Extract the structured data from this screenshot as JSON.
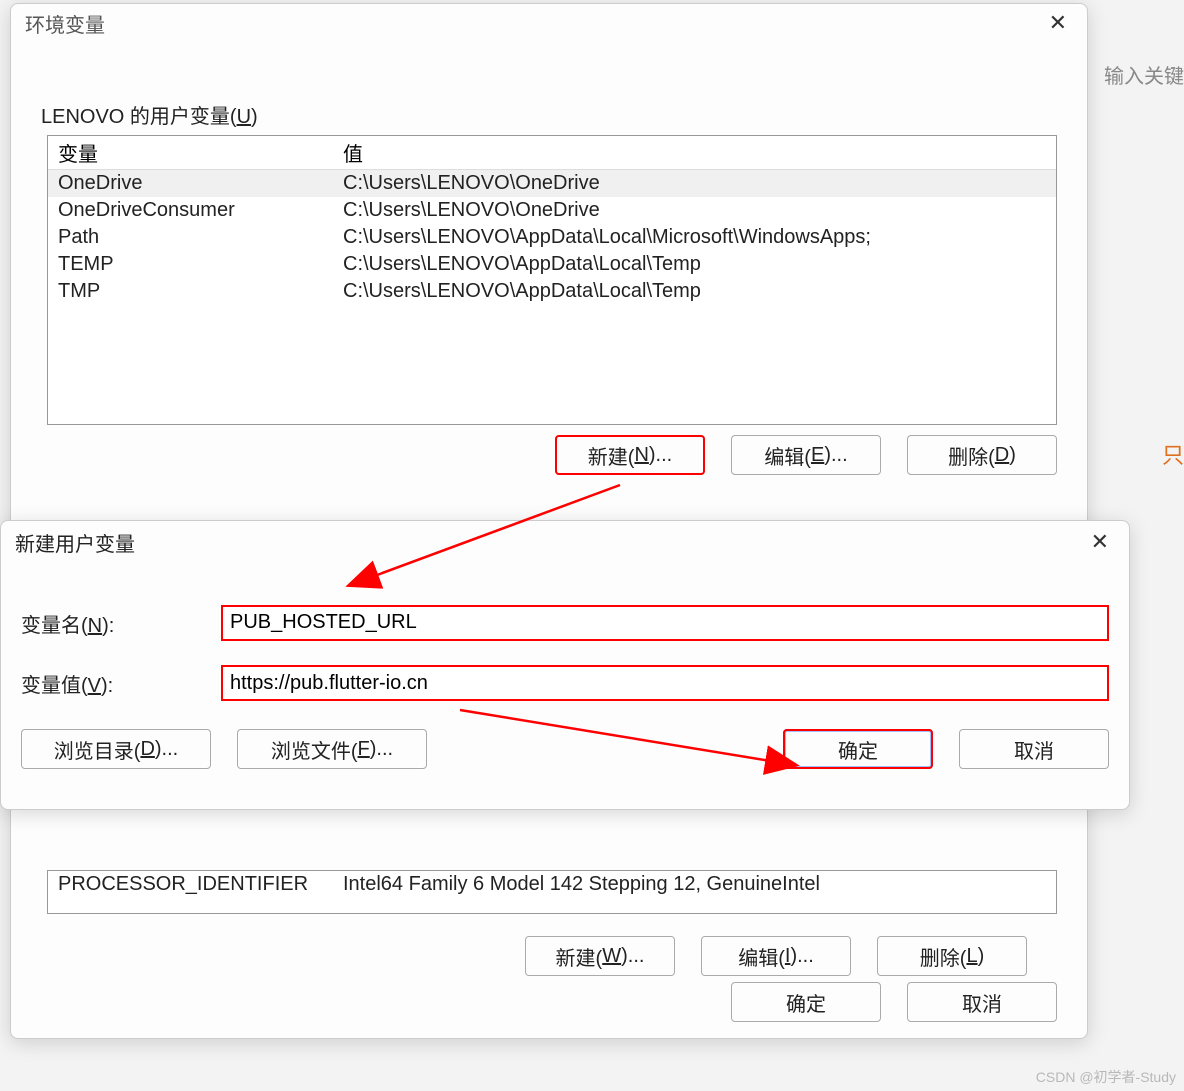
{
  "env_dialog": {
    "title": "环境变量",
    "user_section_label_pre": "LENOVO 的用户变量(",
    "user_section_label_u": "U",
    "user_section_label_post": ")",
    "headers": {
      "var": "变量",
      "val": "值"
    },
    "user_vars": [
      {
        "name": "OneDrive",
        "value": "C:\\Users\\LENOVO\\OneDrive",
        "selected": true
      },
      {
        "name": "OneDriveConsumer",
        "value": "C:\\Users\\LENOVO\\OneDrive"
      },
      {
        "name": "Path",
        "value": "C:\\Users\\LENOVO\\AppData\\Local\\Microsoft\\WindowsApps;"
      },
      {
        "name": "TEMP",
        "value": "C:\\Users\\LENOVO\\AppData\\Local\\Temp"
      },
      {
        "name": "TMP",
        "value": "C:\\Users\\LENOVO\\AppData\\Local\\Temp"
      }
    ],
    "buttons_user": {
      "new_pre": "新建(",
      "new_u": "N",
      "new_post": ")...",
      "edit_pre": "编辑(",
      "edit_u": "E",
      "edit_post": ")...",
      "del_pre": "删除(",
      "del_u": "D",
      "del_post": ")"
    },
    "sys_var_visible": {
      "name": "PROCESSOR_IDENTIFIER",
      "value": "Intel64 Family 6 Model 142 Stepping 12, GenuineIntel"
    },
    "buttons_sys": {
      "new_pre": "新建(",
      "new_u": "W",
      "new_post": ")...",
      "edit_pre": "编辑(",
      "edit_u": "I",
      "edit_post": ")...",
      "del_pre": "删除(",
      "del_u": "L",
      "del_post": ")"
    },
    "ok": "确定",
    "cancel": "取消"
  },
  "new_var_dialog": {
    "title": "新建用户变量",
    "name_label_pre": "变量名(",
    "name_label_u": "N",
    "name_label_post": "):",
    "value_label_pre": "变量值(",
    "value_label_u": "V",
    "value_label_post": "):",
    "name_value": "PUB_HOSTED_URL",
    "value_value": "https://pub.flutter-io.cn",
    "browse_dir_pre": "浏览目录(",
    "browse_dir_u": "D",
    "browse_dir_post": ")...",
    "browse_file_pre": "浏览文件(",
    "browse_file_u": "F",
    "browse_file_post": ")...",
    "ok": "确定",
    "cancel": "取消"
  },
  "background_hints": {
    "search_placeholder": "输入关键",
    "right_orange": "只"
  },
  "watermark": "CSDN @初学者-Study"
}
